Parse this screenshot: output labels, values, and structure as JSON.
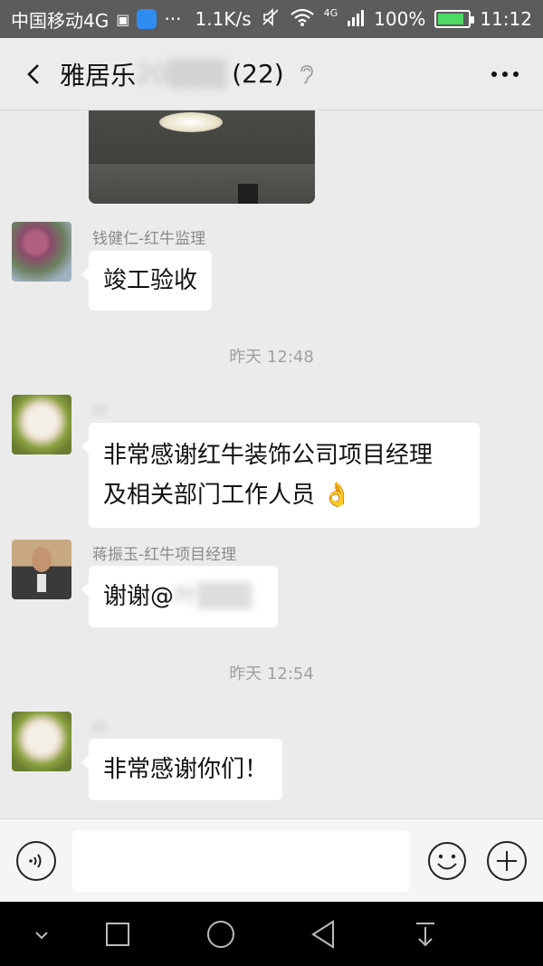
{
  "status_bar": {
    "carrier": "中国移动4G",
    "speed": "1.1K/s",
    "network": "4G",
    "battery": "100%",
    "time": "11:12"
  },
  "header": {
    "title": "雅居乐",
    "member_count": "(22)"
  },
  "messages": [
    {
      "sender": "钱健仁-红牛监理",
      "text": "竣工验收"
    },
    {
      "time": "昨天 12:48"
    },
    {
      "sender": "叶",
      "text_line1": "非常感谢红牛装饰公司项目经理",
      "text_line2": "及相关部门工作人员"
    },
    {
      "sender": "蒋振玉-红牛项目经理",
      "text": "谢谢@",
      "mention_blurred": "叶"
    },
    {
      "time": "昨天 12:54"
    },
    {
      "sender": "叶",
      "text": "非常感谢你们！"
    }
  ],
  "input": {
    "value": "",
    "placeholder": ""
  },
  "icons": {
    "back": "back-arrow-icon",
    "ear": "ear-icon",
    "more": "more-icon",
    "voice": "voice-icon",
    "emoji": "emoji-icon",
    "plus": "plus-icon",
    "nav_down": "chevron-down-icon",
    "nav_recent": "square-icon",
    "nav_home": "circle-icon",
    "nav_back": "triangle-icon",
    "nav_pull": "pull-down-icon"
  }
}
